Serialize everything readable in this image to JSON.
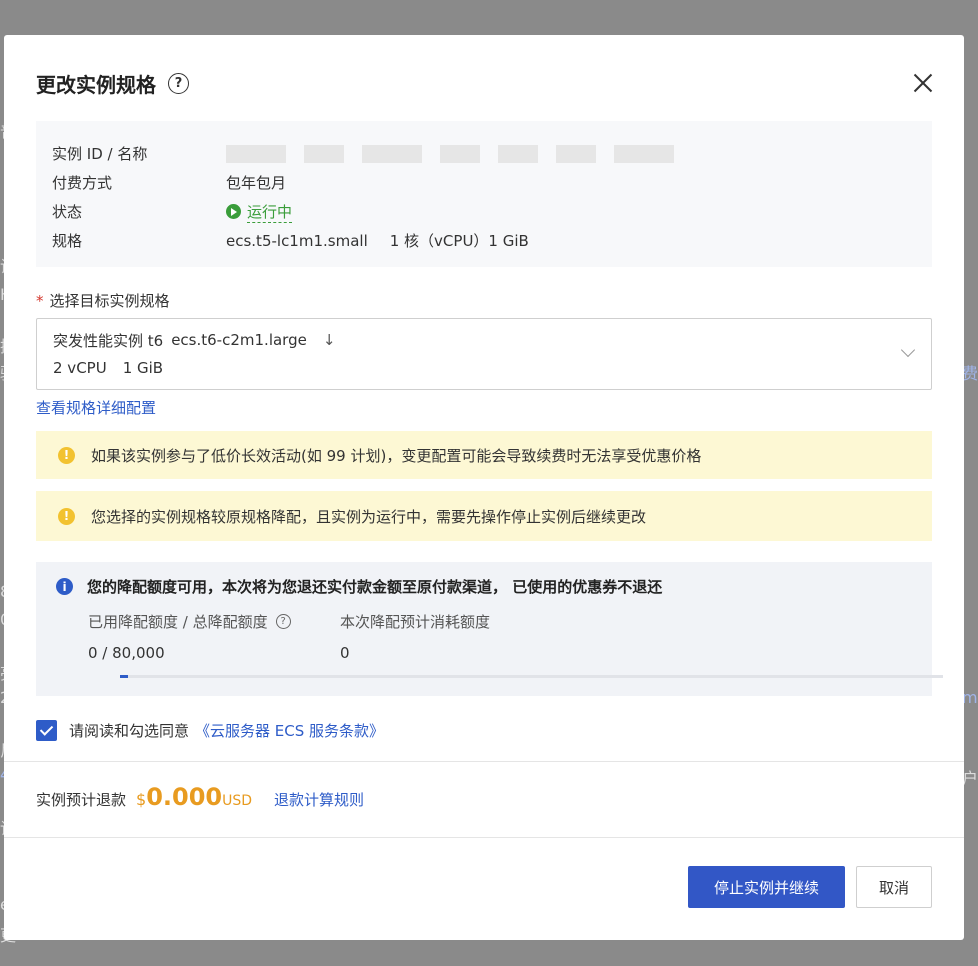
{
  "backdrop": {
    "fragments": [
      "普",
      "设",
      "H",
      "拨",
      "驱",
      "费",
      "8",
      "0",
      "亮",
      "2",
      "mi",
      "尼",
      "户",
      "4",
      "请",
      "e",
      "更"
    ]
  },
  "dialog": {
    "title": "更改实例规格",
    "instance_info": {
      "id_label": "实例 ID / 名称",
      "pay_label": "付费方式",
      "pay_value": "包年包月",
      "status_label": "状态",
      "status_value": "运行中",
      "spec_label": "规格",
      "spec_code": "ecs.t5-lc1m1.small",
      "spec_detail": "1 核（vCPU）1 GiB"
    },
    "target_select": {
      "label": "选择目标实例规格",
      "family": "突发性能实例 t6",
      "code": "ecs.t6-c2m1.large",
      "vcpu": "2 vCPU",
      "memory": "1 GiB"
    },
    "detail_link": "查看规格详细配置",
    "warning_1": "如果该实例参与了低价长效活动(如 99 计划)，变更配置可能会导致续费时无法享受优惠价格",
    "warning_2": "您选择的实例规格较原规格降配，且实例为运行中，需要先操作停止实例后继续更改",
    "quota": {
      "heading": "您的降配额度可用，本次将为您退还实付款金额至原付款渠道， 已使用的优惠券不退还",
      "used_label": "已用降配额度 / 总降配额度",
      "used_value": "0 / 80,000",
      "consume_label": "本次降配预计消耗额度",
      "consume_value": "0",
      "progress_fraction": 0.01
    },
    "agree_text": "请阅读和勾选同意",
    "terms_link": "《云服务器 ECS 服务条款》",
    "refund": {
      "label": "实例预计退款",
      "currency_symbol": "$",
      "amount": "0.000",
      "unit": "USD",
      "rule_link": "退款计算规则"
    },
    "buttons": {
      "primary": "停止实例并继续",
      "cancel": "取消"
    }
  },
  "colors": {
    "accent": "#3257c6",
    "running": "#3a9d3a",
    "warning": "#f2c230",
    "refund": "#e89b20"
  }
}
